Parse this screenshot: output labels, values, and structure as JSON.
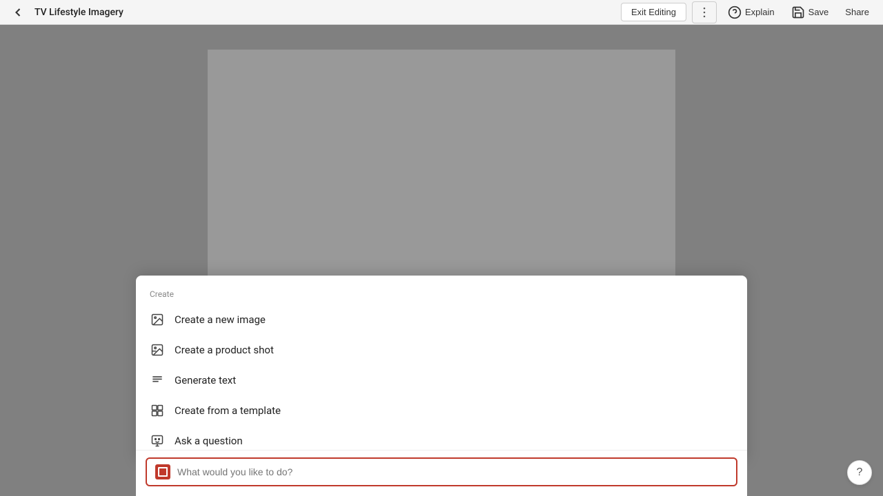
{
  "header": {
    "title": "TV Lifestyle Imagery",
    "back_label": "back",
    "exit_editing_label": "Exit Editing",
    "more_label": "...",
    "explain_label": "Explain",
    "save_label": "Save",
    "share_label": "Share"
  },
  "create_panel": {
    "section_label": "Create",
    "items": [
      {
        "id": "new-image",
        "label": "Create a new image",
        "icon": "image-icon"
      },
      {
        "id": "product-shot",
        "label": "Create a product shot",
        "icon": "product-icon"
      },
      {
        "id": "generate-text",
        "label": "Generate text",
        "icon": "text-lines-icon"
      },
      {
        "id": "from-template",
        "label": "Create from a template",
        "icon": "template-icon"
      },
      {
        "id": "ask-question",
        "label": "Ask a question",
        "icon": "question-icon"
      }
    ]
  },
  "input_bar": {
    "placeholder": "What would you like to do?"
  },
  "help": {
    "label": "?"
  }
}
